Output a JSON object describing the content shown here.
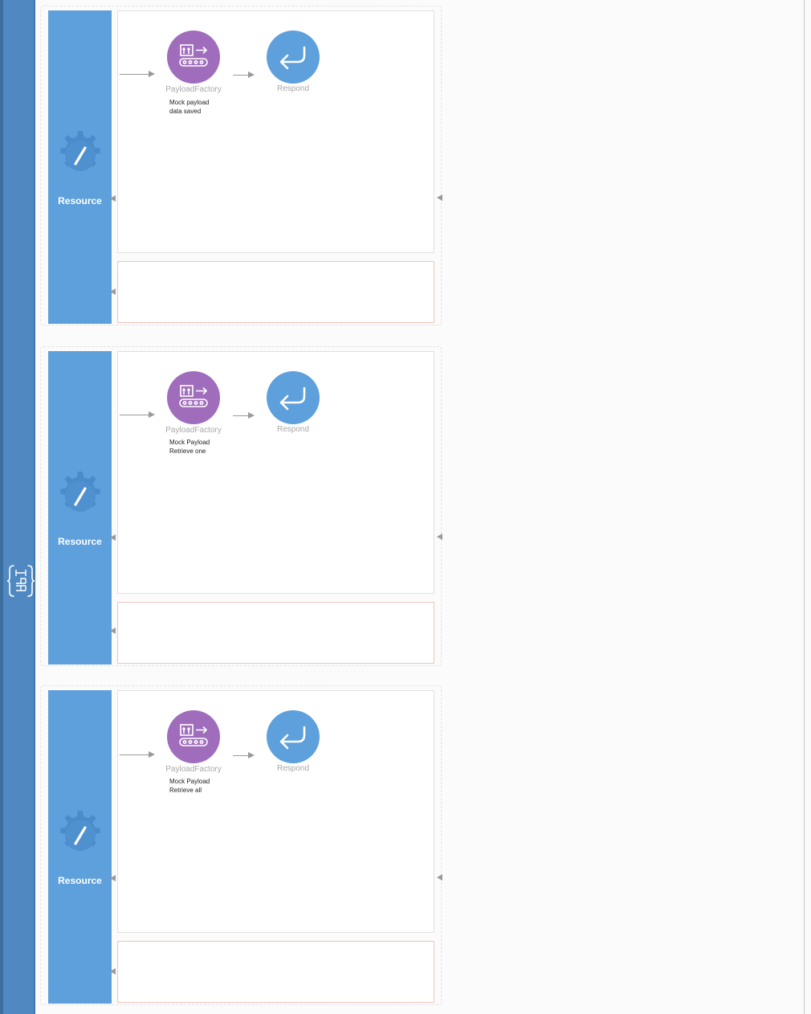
{
  "api": {
    "icon": "api-braces-icon",
    "label": "API"
  },
  "resources": [
    {
      "label": "Resource",
      "mediator": "PayloadFactory",
      "description_line1": "Mock payload",
      "description_line2": "data saved",
      "respond": "Respond"
    },
    {
      "label": "Resource",
      "mediator": "PayloadFactory",
      "description_line1": "Mock Payload",
      "description_line2": "Retrieve one",
      "respond": "Respond"
    },
    {
      "label": "Resource",
      "mediator": "PayloadFactory",
      "description_line1": "Mock Payload",
      "description_line2": "Retrieve all",
      "respond": "Respond"
    }
  ],
  "colors": {
    "api_sidebar": "#5089c1",
    "resource_bar": "#5ea0dc",
    "payload_factory": "#a06dbd",
    "respond": "#5ea0dc",
    "fault_border": "#f0c4bd"
  }
}
